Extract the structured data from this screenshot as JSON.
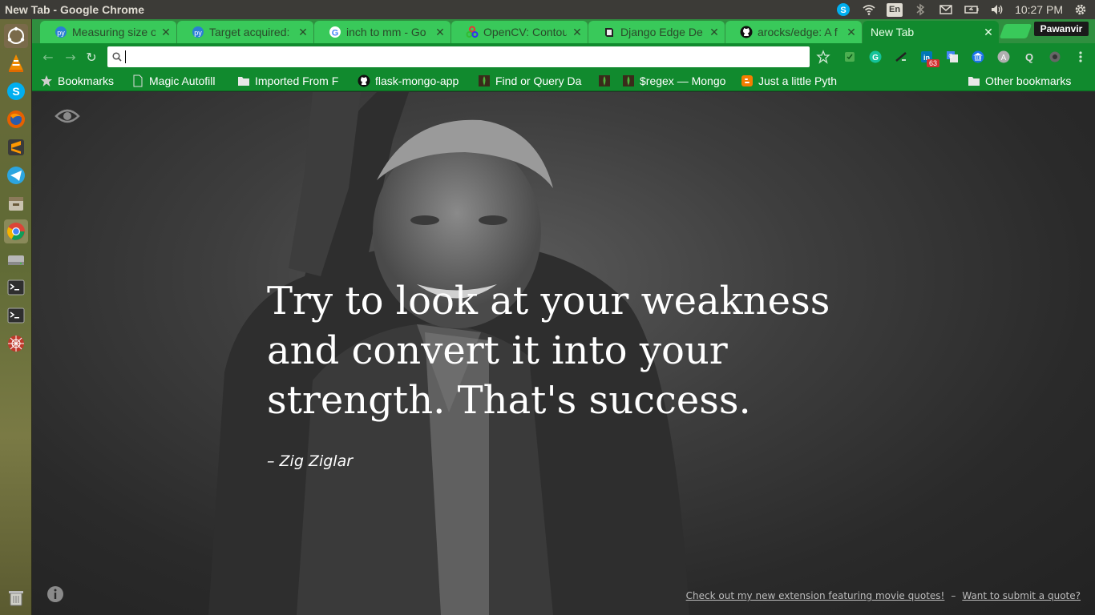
{
  "panel": {
    "window_title": "New Tab - Google Chrome",
    "lang": "En",
    "clock": "10:27 PM",
    "indicators": [
      "skype-icon",
      "wifi-icon",
      "bluetooth-icon",
      "mail-icon",
      "battery-icon",
      "volume-icon",
      "settings-gear-icon"
    ]
  },
  "launcher": {
    "items": [
      "ubuntu-dash",
      "vlc",
      "skype",
      "firefox",
      "sublime-text",
      "telegram",
      "files-archive",
      "chrome",
      "disk-drive",
      "terminal",
      "terminal-2",
      "network-tool",
      "trash"
    ]
  },
  "tabs": [
    {
      "title": "Measuring size o",
      "favicon": "pyimagesearch-icon"
    },
    {
      "title": "Target acquired:",
      "favicon": "pyimagesearch-icon"
    },
    {
      "title": "inch to mm - Go",
      "favicon": "google-icon"
    },
    {
      "title": "OpenCV: Contou",
      "favicon": "opencv-icon"
    },
    {
      "title": "Django Edge De",
      "favicon": "book-icon"
    },
    {
      "title": "arocks/edge: A f",
      "favicon": "github-icon"
    },
    {
      "title": "New Tab",
      "favicon": ""
    }
  ],
  "profile": {
    "name": "Pawanvir"
  },
  "omnibox": {
    "value": "",
    "placeholder": ""
  },
  "extensions": {
    "badge": "63"
  },
  "bookmarks": [
    {
      "label": "Bookmarks",
      "icon": "star-icon"
    },
    {
      "label": "Magic Autofill",
      "icon": "page-icon"
    },
    {
      "label": "Imported From F",
      "icon": "folder-icon"
    },
    {
      "label": "flask-mongo-app",
      "icon": "github-icon"
    },
    {
      "label": "Find or Query Da",
      "icon": "mongodb-icon"
    },
    {
      "label": "",
      "icon": "mongodb-icon"
    },
    {
      "label": "$regex — Mongo",
      "icon": "mongodb-icon"
    },
    {
      "label": "Just a little Pyth",
      "icon": "blogger-icon"
    }
  ],
  "other_bookmarks": "Other bookmarks",
  "quote": {
    "text": "Try to look at your weakness and convert it into your strength. That's success.",
    "author": "– Zig Ziglar"
  },
  "footer": {
    "link1": "Check out my new extension featuring movie quotes!",
    "separator": "–",
    "link2": "Want to submit a quote?"
  }
}
